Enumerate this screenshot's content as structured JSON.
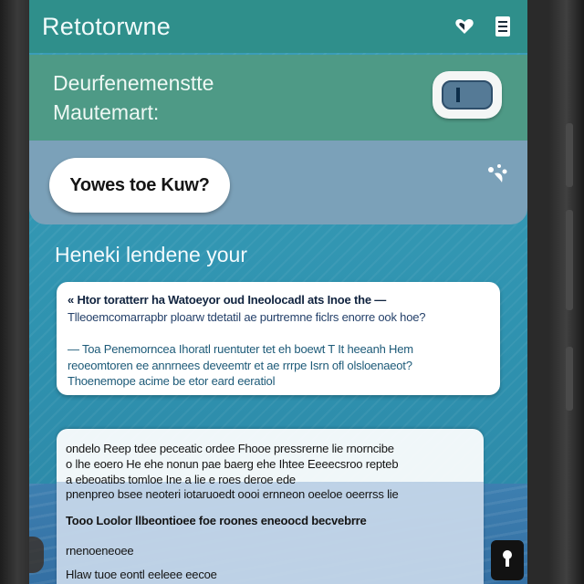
{
  "appbar": {
    "title": "Retotorwne",
    "heart_icon": "heart-icon",
    "menu_icon": "bookmark-list-icon"
  },
  "header": {
    "line1": "Deurfenemenstte",
    "line2": "Mautemart:",
    "toggle_icon": "toggle-switch-icon"
  },
  "query": {
    "pill_label": "Yowes toe Kuw?",
    "magic_icon": "sparkle-wand-icon"
  },
  "section": {
    "heading": "Heneki lendene your"
  },
  "info_card": {
    "line1": "« Htor toratterr ha Watoeyor oud Ineolocadl ats Inoe the —",
    "line2": "Tlleoemcomarrapbr ploarw tdetatil ae purtremne ficlrs enorre ook hoe?",
    "line3": "— Toa Penemorncea Ihoratl ruentuter tet eh boewt T It heeanh Hem",
    "line4": "reoeomtoren ee annrnees deveemtr et ae rrrpe Isrn ofl olsloenaeot?",
    "line5": "Thoenemope acime be etor eard eeratiol"
  },
  "result_card": {
    "line1": "ondelo Reep tdee peceatic ordee Fhooe pressrerne lie rnorncibe",
    "line2": "o lhe eoero He ehe nonun pae baerg ehe Ihtee Eeeecsroo repteb",
    "line3": "a ebeoatibs tomloe Ine a lie e roes deroe ede",
    "line4": "pnenpreo bsee neoteri iotaruoedt oooi ernneon oeeloe oeerrss lie",
    "line5": "Tooo Loolor llbeontioee foe roones eneoocd becvebrre",
    "line6": "rnenoeneoee",
    "line7": "Hlaw tuoe eontl eeleee eecoe"
  },
  "fab": {
    "icon": "lock-icon"
  },
  "colors": {
    "appbar": "#2f8f8b",
    "header": "#4e9a86",
    "query_band": "#7ba1b9",
    "screen": "#3c9fb9"
  }
}
